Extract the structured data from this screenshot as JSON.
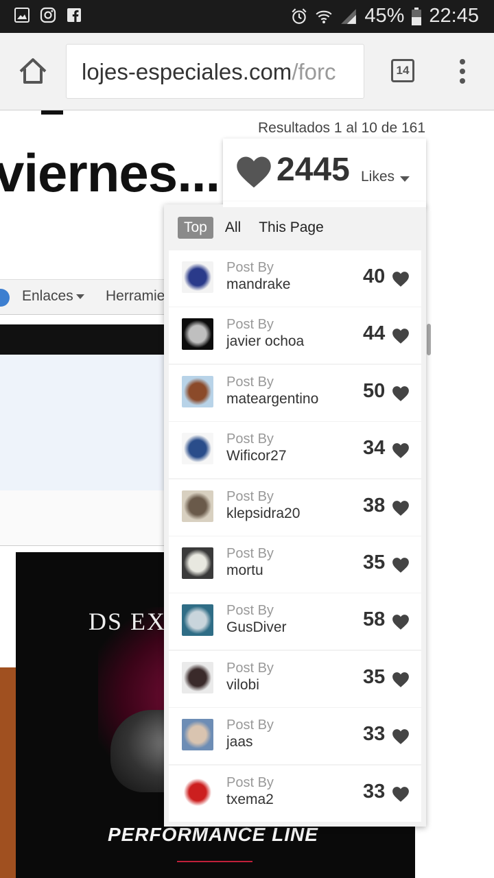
{
  "status_bar": {
    "left_icons": [
      "image-icon",
      "instagram-icon",
      "facebook-icon"
    ],
    "right_icons": [
      "alarm-icon",
      "wifi-icon",
      "signal-icon",
      "battery-icon"
    ],
    "battery": "45%",
    "time": "22:45"
  },
  "browser": {
    "url_domain": "lojes-especiales.com",
    "url_path": "/forc",
    "tab_count": "14"
  },
  "page": {
    "results": "Resultados 1 al 10 de 161",
    "title": "viernes...",
    "nav": {
      "enlaces": "Enlaces",
      "herramientas": "Herramie"
    },
    "ad": {
      "brand": "DS EX",
      "tagline": "PERFORMANCE LINE"
    }
  },
  "likes": {
    "count": "2445",
    "label": "Likes",
    "filters": [
      {
        "label": "Top",
        "active": true
      },
      {
        "label": "All",
        "active": false
      },
      {
        "label": "This Page",
        "active": false
      }
    ],
    "post_by_label": "Post By",
    "posts": [
      {
        "user": "mandrake",
        "likes": "40",
        "thumb": "magician",
        "thumb_colors": [
          "#f3f3f3",
          "#2a3a8a"
        ]
      },
      {
        "user": "javier ochoa",
        "likes": "44",
        "thumb": "watch",
        "thumb_colors": [
          "#0c0c0c",
          "#bfbfbf"
        ]
      },
      {
        "user": "mateargentino",
        "likes": "50",
        "thumb": "mate-cup",
        "thumb_colors": [
          "#b8d3e8",
          "#8b4a2a"
        ]
      },
      {
        "user": "Wificor27",
        "likes": "34",
        "thumb": "watch",
        "thumb_colors": [
          "#f6f6f6",
          "#2a4d8a"
        ]
      },
      {
        "user": "klepsidra20",
        "likes": "38",
        "thumb": "sundial",
        "thumb_colors": [
          "#d8d0c0",
          "#6a5a4a"
        ]
      },
      {
        "user": "mortu",
        "likes": "35",
        "thumb": "watch",
        "thumb_colors": [
          "#3a3a3a",
          "#e8e8e0"
        ]
      },
      {
        "user": "GusDiver",
        "likes": "58",
        "thumb": "shark",
        "thumb_colors": [
          "#2f6d86",
          "#c9d5dc"
        ]
      },
      {
        "user": "vilobi",
        "likes": "35",
        "thumb": "watch",
        "thumb_colors": [
          "#eaeaea",
          "#3a2a2a"
        ]
      },
      {
        "user": "jaas",
        "likes": "33",
        "thumb": "wrist-watch",
        "thumb_colors": [
          "#6d8db5",
          "#d9c4b0"
        ]
      },
      {
        "user": "txema2",
        "likes": "33",
        "thumb": "logo",
        "thumb_colors": [
          "#ffffff",
          "#cc1f1f"
        ]
      }
    ]
  }
}
